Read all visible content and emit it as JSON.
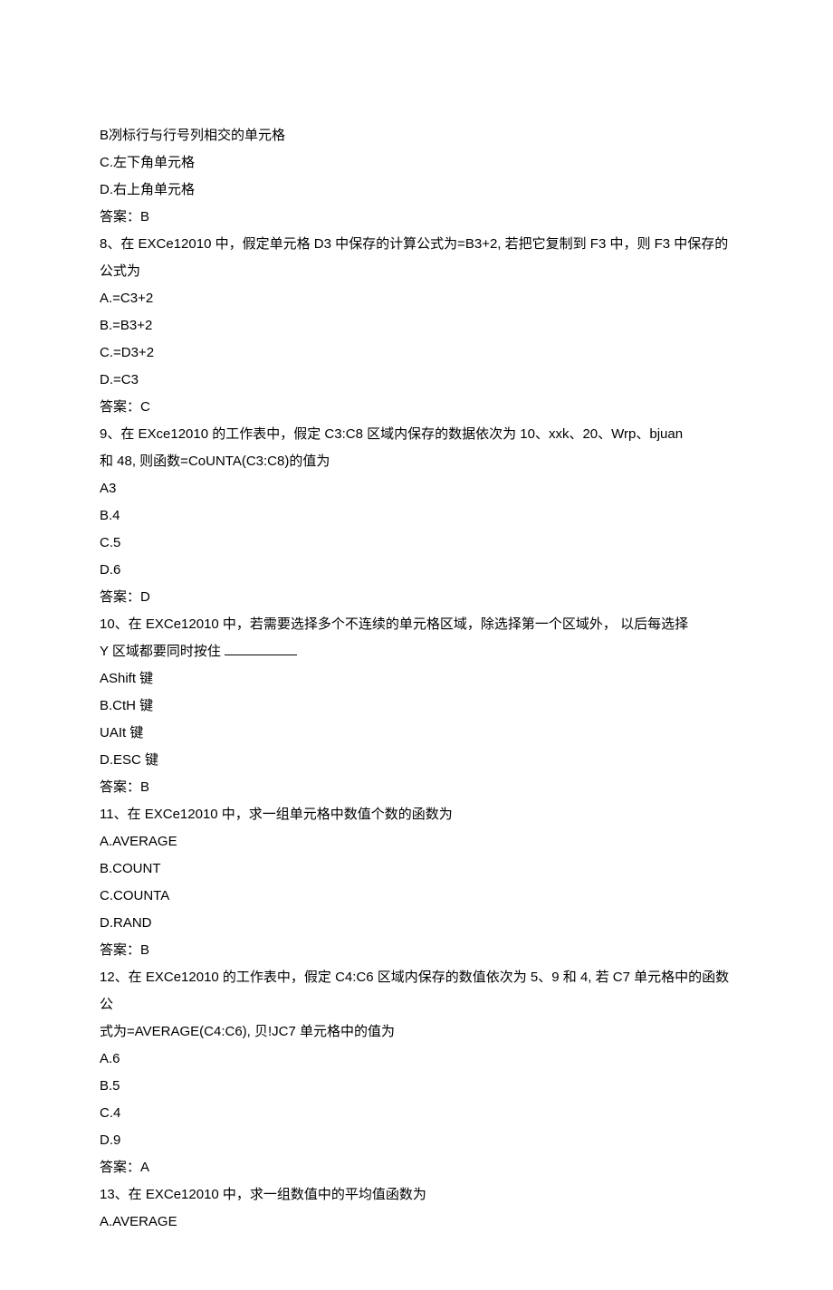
{
  "q7": {
    "optB": "B冽标行与行号列相交的单元格",
    "optC": "C.左下角单元格",
    "optD": "D.右上角单元格",
    "answer": "答案：B"
  },
  "q8": {
    "stem": "8、在 EXCe12010 中，假定单元格 D3 中保存的计算公式为=B3+2, 若把它复制到 F3 中，则 F3 中保存的公式为",
    "optA": "A.=C3+2",
    "optB": "B.=B3+2",
    "optC": "C.=D3+2",
    "optD": "D.=C3",
    "answer": "答案：C"
  },
  "q9": {
    "stem1": "9、在 EXce12010 的工作表中，假定 C3:C8 区域内保存的数据依次为 10、xxk、20、Wrp、bjuan",
    "stem2": "和 48, 则函数=CoUNTA(C3:C8)的值为",
    "optA": "A3",
    "optB": "B.4",
    "optC": "C.5",
    "optD": "D.6",
    "answer": "答案：D"
  },
  "q10": {
    "stem1": "10、在 EXCe12010 中，若需要选择多个不连续的单元格区域，除选择第一个区域外， 以后每选择",
    "stem2": "Y 区域都要同时按住",
    "optA": "AShift 键",
    "optB": "B.CtH 键",
    "optC": "UAIt 键",
    "optD": "D.ESC 键",
    "answer": "答案：B"
  },
  "q11": {
    "stem": "11、在 EXCe12010 中，求一组单元格中数值个数的函数为",
    "optA": "A.AVERAGE",
    "optB": "B.COUNT",
    "optC": "C.COUNTA",
    "optD": "D.RAND",
    "answer": "答案：B"
  },
  "q12": {
    "stem1": "12、在 EXCe12010 的工作表中，假定 C4:C6 区域内保存的数值依次为 5、9 和 4, 若 C7 单元格中的函数公",
    "stem2": "式为=AVERAGE(C4:C6), 贝!JC7 单元格中的值为",
    "optA": "A.6",
    "optB": "B.5",
    "optC": "C.4",
    "optD": "D.9",
    "answer": "答案：A"
  },
  "q13": {
    "stem": "13、在 EXCe12010 中，求一组数值中的平均值函数为",
    "optA": "A.AVERAGE"
  }
}
